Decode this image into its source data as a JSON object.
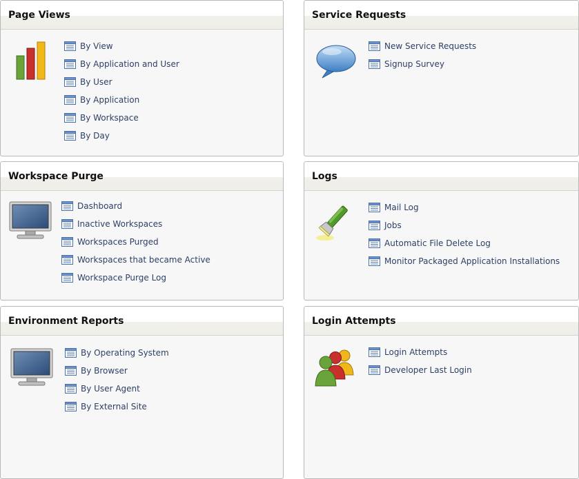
{
  "colors": {
    "header": "#efeee8",
    "panel": "#f7f7f7",
    "border": "#b8b8b8",
    "link": "#2d4066"
  },
  "panels": {
    "page_views": {
      "title": "Page Views",
      "icon": "bar-chart-icon",
      "links": [
        "By View",
        "By Application and User",
        "By User",
        "By Application",
        "By Workspace",
        "By Day"
      ]
    },
    "service_requests": {
      "title": "Service Requests",
      "icon": "speech-bubble-icon",
      "links": [
        "New Service Requests",
        "Signup Survey"
      ]
    },
    "workspace_purge": {
      "title": "Workspace Purge",
      "icon": "monitor-icon",
      "links": [
        "Dashboard",
        "Inactive Workspaces",
        "Workspaces Purged",
        "Workspaces that became Active",
        "Workspace Purge Log"
      ]
    },
    "logs": {
      "title": "Logs",
      "icon": "flashlight-icon",
      "links": [
        "Mail Log",
        "Jobs",
        "Automatic File Delete Log",
        "Monitor Packaged Application Installations"
      ]
    },
    "environment_reports": {
      "title": "Environment Reports",
      "icon": "monitor-icon",
      "links": [
        "By Operating System",
        "By Browser",
        "By User Agent",
        "By External Site"
      ]
    },
    "login_attempts": {
      "title": "Login Attempts",
      "icon": "users-icon",
      "links": [
        "Login Attempts",
        "Developer Last Login"
      ]
    }
  }
}
